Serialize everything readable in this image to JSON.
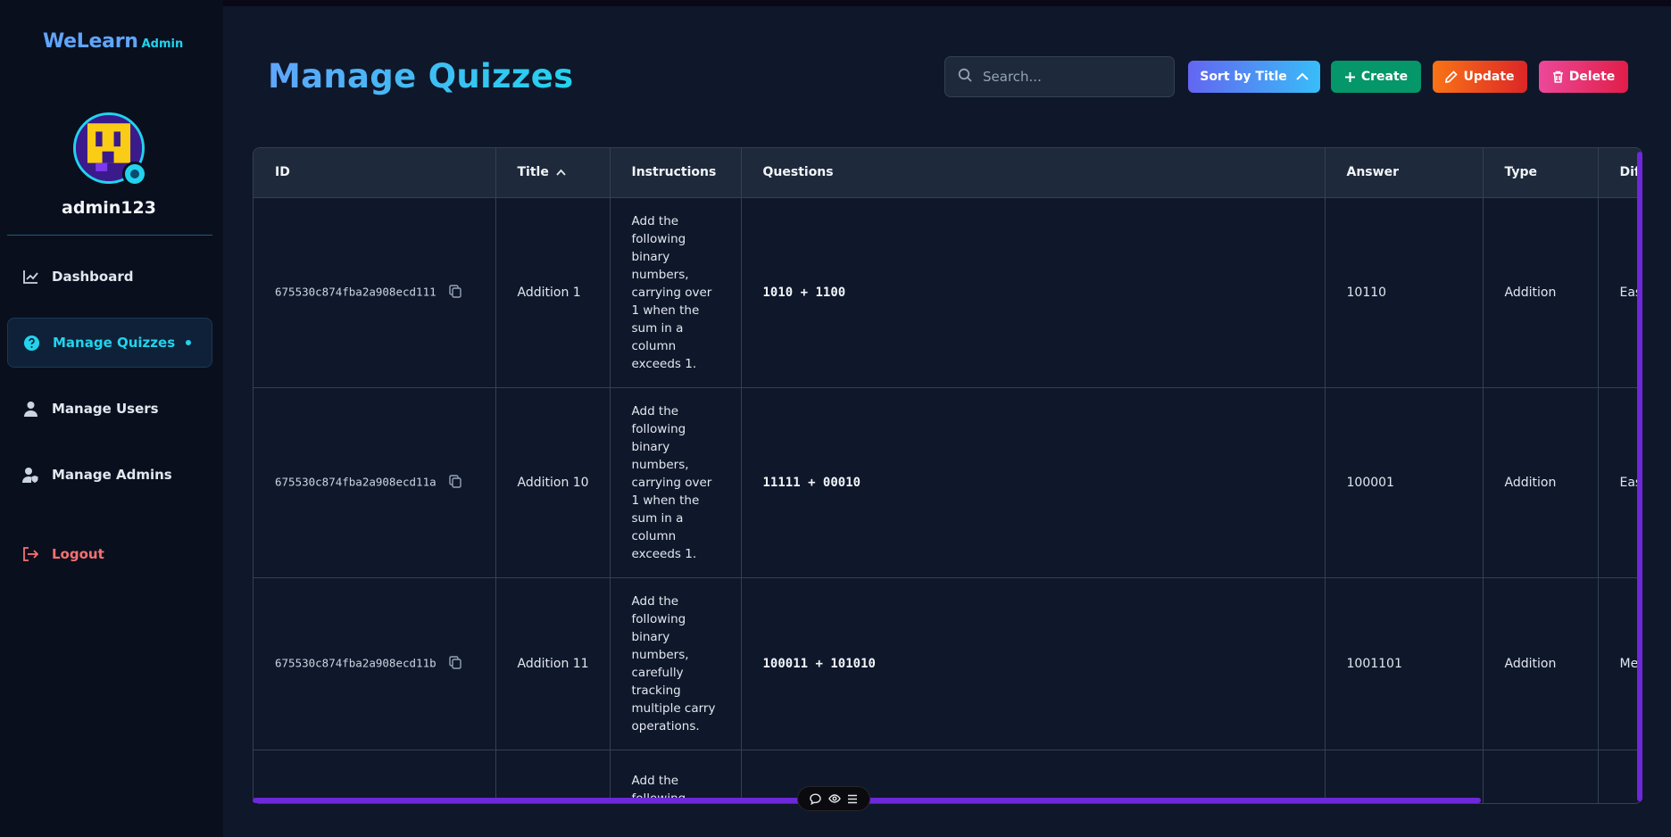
{
  "brand": {
    "name": "WeLearn",
    "sub": "Admin"
  },
  "user": {
    "name": "admin123"
  },
  "nav": {
    "dashboard": "Dashboard",
    "quizzes": "Manage Quizzes",
    "users": "Manage Users",
    "admins": "Manage Admins",
    "logout": "Logout"
  },
  "page": {
    "title": "Manage Quizzes"
  },
  "search": {
    "placeholder": "Search..."
  },
  "toolbar": {
    "sort": "Sort by Title",
    "create": "Create",
    "update": "Update",
    "delete": "Delete"
  },
  "table": {
    "headers": {
      "id": "ID",
      "title": "Title",
      "instructions": "Instructions",
      "questions": "Questions",
      "answer": "Answer",
      "type": "Type",
      "difficulty": "Dif"
    },
    "rows": [
      {
        "id": "675530c874fba2a908ecd111",
        "title": "Addition 1",
        "instructions": "Add the following binary numbers, carrying over 1 when the sum in a column exceeds 1.",
        "question": "1010 + 1100",
        "answer": "10110",
        "type": "Addition",
        "difficulty": "Eas"
      },
      {
        "id": "675530c874fba2a908ecd11a",
        "title": "Addition 10",
        "instructions": "Add the following binary numbers, carrying over 1 when the sum in a column exceeds 1.",
        "question": "11111 + 00010",
        "answer": "100001",
        "type": "Addition",
        "difficulty": "Eas"
      },
      {
        "id": "675530c874fba2a908ecd11b",
        "title": "Addition 11",
        "instructions": "Add the following binary numbers, carefully tracking multiple carry operations.",
        "question": "100011 + 101010",
        "answer": "1001101",
        "type": "Addition",
        "difficulty": "Me"
      },
      {
        "id": "",
        "title": "",
        "instructions": "Add the following",
        "question": "",
        "answer": "",
        "type": "",
        "difficulty": ""
      }
    ]
  },
  "colors": {
    "accent": "#22d3ee",
    "brand": "#60a5fa",
    "scrollbar": "#6d28d9"
  }
}
